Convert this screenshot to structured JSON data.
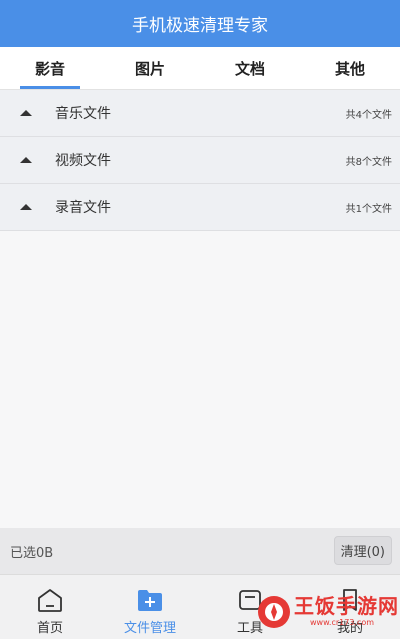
{
  "app": {
    "title": "手机极速清理专家"
  },
  "tabs": [
    {
      "label": "影音",
      "active": true
    },
    {
      "label": "图片",
      "active": false
    },
    {
      "label": "文档",
      "active": false
    },
    {
      "label": "其他",
      "active": false
    }
  ],
  "categories": [
    {
      "label": "音乐文件",
      "count": "共4个文件"
    },
    {
      "label": "视频文件",
      "count": "共8个文件"
    },
    {
      "label": "录音文件",
      "count": "共1个文件"
    }
  ],
  "status": {
    "selected": "已选0B",
    "clean_button": "清理(0)"
  },
  "bottom_nav": [
    {
      "label": "首页",
      "icon": "home-icon",
      "active": false
    },
    {
      "label": "文件管理",
      "icon": "file-manager-icon",
      "active": true
    },
    {
      "label": "工具",
      "icon": "tools-icon",
      "active": false
    },
    {
      "label": "我的",
      "icon": "profile-icon",
      "active": false
    }
  ],
  "watermark": {
    "text": "王饭手游网",
    "sub": "www.cr173.com"
  },
  "colors": {
    "accent": "#4a8fe7",
    "watermark": "#e53935"
  }
}
